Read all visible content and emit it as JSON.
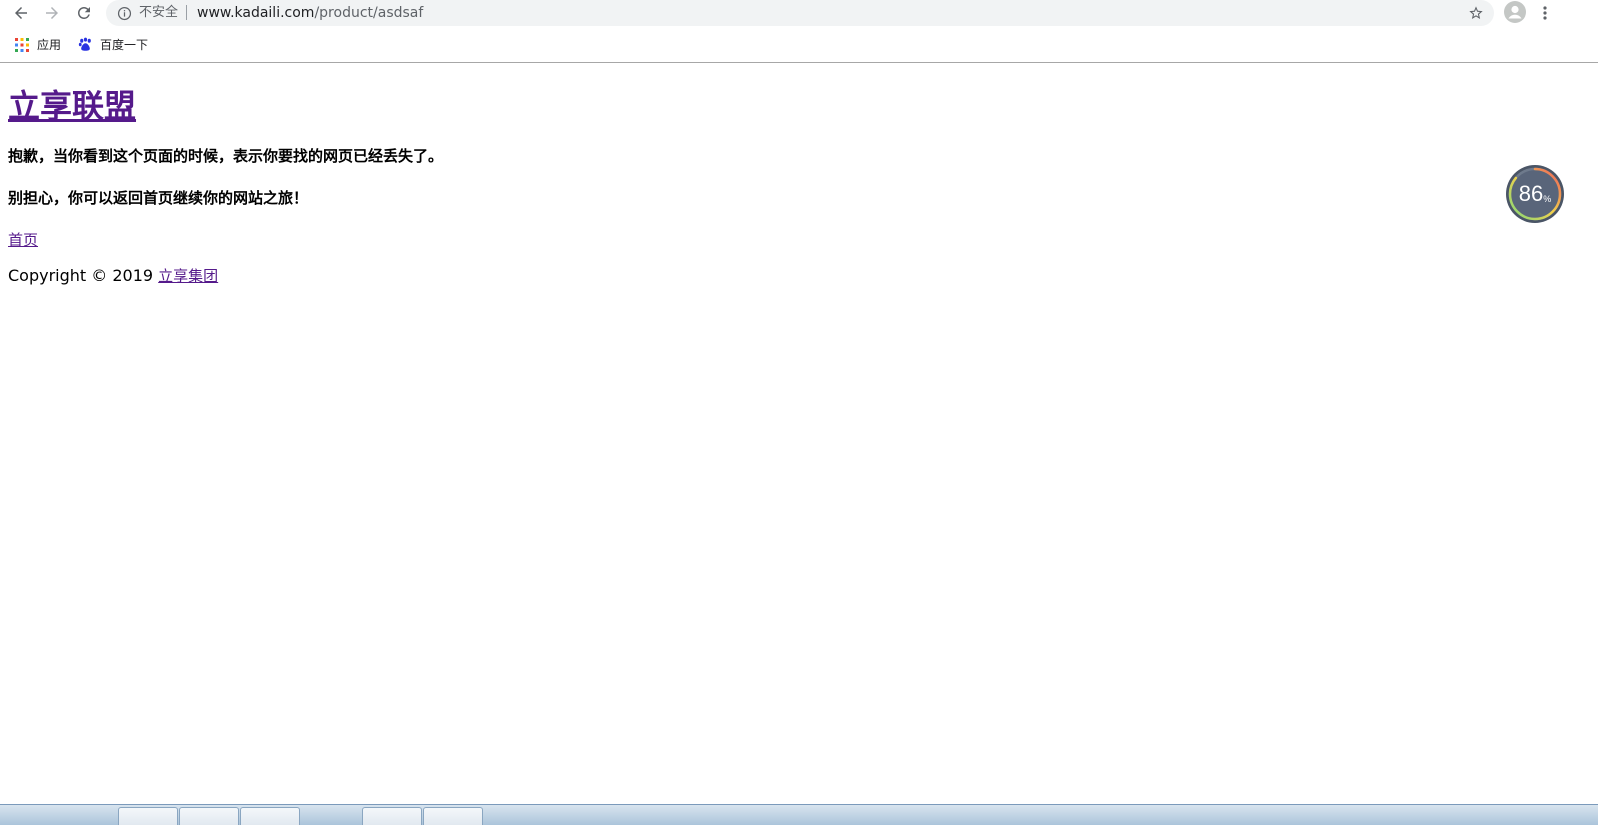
{
  "browser": {
    "security_label": "不安全",
    "url_host": "www.kadaili.com",
    "url_path": "/product/asdsaf",
    "icons": {
      "back": "arrow-left-icon",
      "forward": "arrow-right-icon",
      "reload": "reload-icon",
      "info": "info-icon",
      "bookmark": "star-icon",
      "profile": "account-icon",
      "menu": "more-vert-icon"
    }
  },
  "bookmarks": [
    {
      "label": "应用",
      "icon": "apps-grid-icon"
    },
    {
      "label": "百度一下",
      "icon": "baidu-paw-icon"
    }
  ],
  "page": {
    "title": "立享联盟",
    "message1": "抱歉，当你看到这个页面的时候，表示你要找的网页已经丢失了。",
    "message2": "别担心，你可以返回首页继续你的网站之旅！",
    "home_link": "首页",
    "copyright_prefix": "Copyright © 2019 ",
    "copyright_link": "立享集团",
    "colors": {
      "link": "#551a8b",
      "text": "#000000"
    }
  },
  "widget": {
    "value": "86",
    "unit": "%",
    "percent": 86
  }
}
